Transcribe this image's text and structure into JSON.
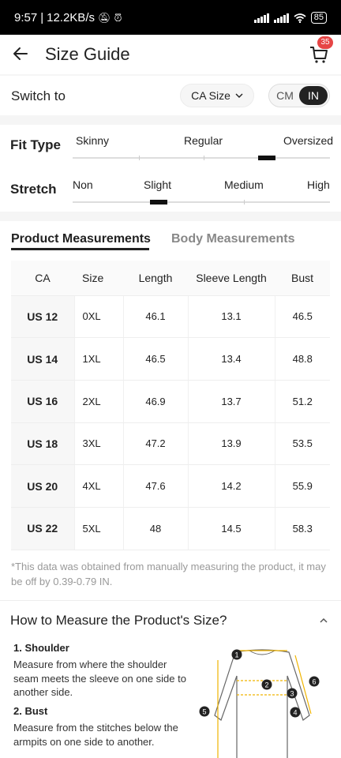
{
  "status": {
    "time": "9:57",
    "net_speed": "12.2KB/s",
    "battery": "85"
  },
  "header": {
    "title": "Size Guide",
    "cart_count": "35"
  },
  "switch": {
    "label": "Switch to",
    "size_system": "CA Size",
    "units": [
      "CM",
      "IN"
    ],
    "active_unit": "IN"
  },
  "fit": {
    "fit_type_label": "Fit Type",
    "fit_options": [
      "Skinny",
      "Regular",
      "Oversized"
    ],
    "fit_value": "Regular–Oversized",
    "stretch_label": "Stretch",
    "stretch_options": [
      "Non",
      "Slight",
      "Medium",
      "High"
    ],
    "stretch_value": "Slight"
  },
  "tabs": {
    "product": "Product Measurements",
    "body": "Body Measurements",
    "active": "product"
  },
  "table": {
    "headers": [
      "CA",
      "Size",
      "Length",
      "Sleeve Length",
      "Bust"
    ],
    "rows": [
      [
        "US 12",
        "0XL",
        "46.1",
        "13.1",
        "46.5"
      ],
      [
        "US 14",
        "1XL",
        "46.5",
        "13.4",
        "48.8"
      ],
      [
        "US 16",
        "2XL",
        "46.9",
        "13.7",
        "51.2"
      ],
      [
        "US 18",
        "3XL",
        "47.2",
        "13.9",
        "53.5"
      ],
      [
        "US 20",
        "4XL",
        "47.6",
        "14.2",
        "55.9"
      ],
      [
        "US 22",
        "5XL",
        "48",
        "14.5",
        "58.3"
      ]
    ]
  },
  "note": "*This data was obtained from manually measuring the product, it may be off by 0.39-0.79 IN.",
  "howto": {
    "title": "How to Measure the Product's Size?",
    "steps": [
      {
        "title": "1. Shoulder",
        "desc": "Measure from where the shoulder seam meets the sleeve on one side to another side."
      },
      {
        "title": "2. Bust",
        "desc": "Measure from the stitches below the armpits on one side to another."
      }
    ],
    "markers": [
      "1",
      "2",
      "3",
      "4",
      "5",
      "6"
    ]
  },
  "colors": {
    "accent": "#222222",
    "badge": "#e64545",
    "diagram_line": "#f0b400"
  }
}
